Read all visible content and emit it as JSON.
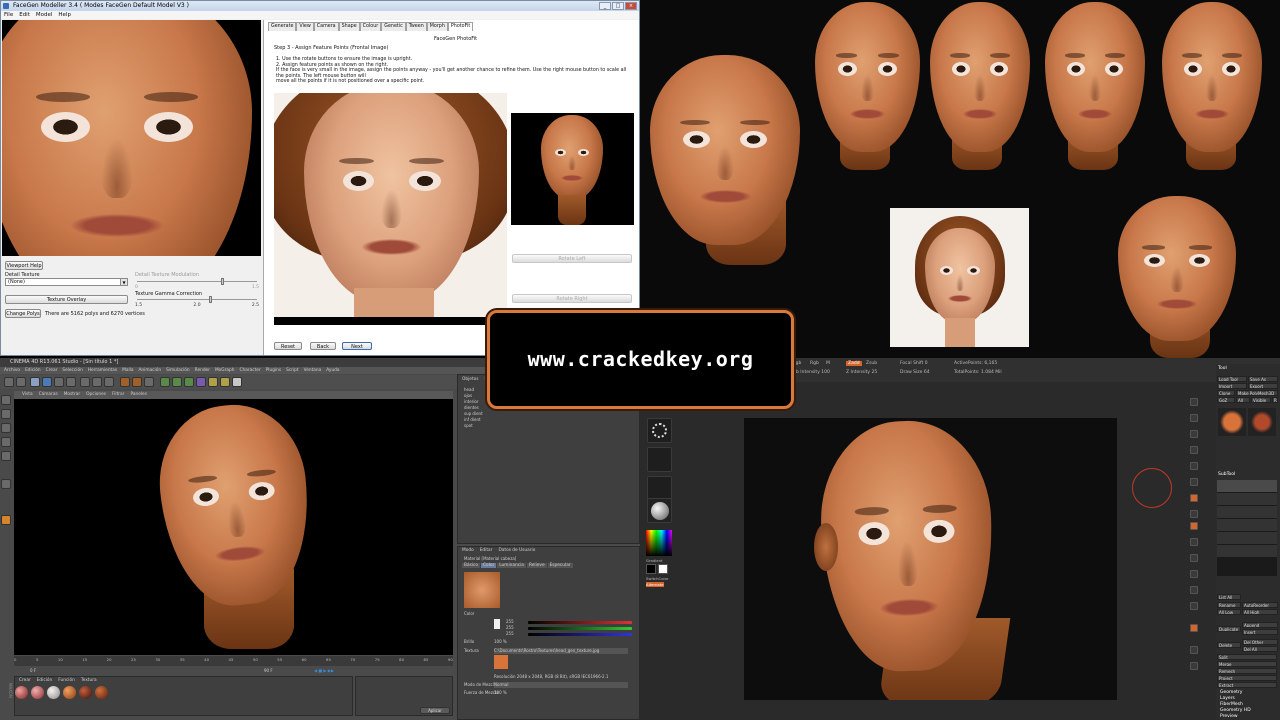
{
  "facegen": {
    "title": "FaceGen Modeller 3.4  ( Modes FaceGen Default Model V3 )",
    "menu": [
      "File",
      "Edit",
      "Model",
      "Help"
    ],
    "viewport_help": "Viewport Help",
    "detail_texture_label": "Detail Texture",
    "detail_texture_value": "(None)",
    "texture_overlay": "Texture Overlay",
    "detail_texture_modulation": "Detail Texture Modulation",
    "modulation_ticks": [
      "0",
      "1.5"
    ],
    "gamma_label": "Texture Gamma Correction",
    "gamma_ticks": [
      "1.5",
      "2.0",
      "2.5"
    ],
    "change_polys": "Change Polys",
    "poly_info": "There are 5162 polys and 6270 vertices",
    "tabs": [
      "Generate",
      "View",
      "Camera",
      "Shape",
      "Colour",
      "Genetic",
      "Tween",
      "Morph",
      "PhotoFit"
    ],
    "photofit_title": "FaceGen PhotoFit",
    "step": "Step 3 - Assign Feature Points (Frontal Image)",
    "instructions": [
      "1. Use the rotate buttons to ensure the image is upright.",
      "2. Assign feature points as shown on the right.",
      "If the face is very small in the image, assign the points anyway - you'll get another chance to refine them. Use the right mouse button to scale all the points. The left mouse button will",
      "move all the points if it is not positioned over a specific point."
    ],
    "rotate_left": "Rotate Left",
    "rotate_right": "Rotate Right",
    "reset": "Reset",
    "back": "Back",
    "next": "Next"
  },
  "banner": {
    "text": "www.crackedkey.org"
  },
  "c4d": {
    "title": "CINEMA 4D R13.061 Studio - [Sin título 1 *]",
    "menu": [
      "Archivo",
      "Edición",
      "Crear",
      "Selección",
      "Herramientas",
      "Malla",
      "Animación",
      "Simulación",
      "Render",
      "MoGraph",
      "Character",
      "Plugins",
      "Script",
      "Ventana",
      "Ayuda"
    ],
    "view_menu": [
      "Vista",
      "Cámaras",
      "Mostrar",
      "Opciones",
      "Filtrar",
      "Paneles"
    ],
    "objects": [
      "Objetos",
      "Etiquetas",
      "Marcadores"
    ],
    "tree_items": [
      "head",
      "ojos",
      "interior",
      "dientes",
      "sup dient",
      "inf dient",
      "spot"
    ],
    "attributes_menu": [
      "Modo",
      "Editar",
      "Datos de Usuario"
    ],
    "material_name": "Material [Material cabeza]",
    "mat_tabs": [
      "Básico",
      "Color",
      "Luminancia",
      "Relieve",
      "Especular"
    ],
    "color_label": "Color",
    "channel_values": [
      "255",
      "255",
      "255"
    ],
    "brightness_label": "Brillo",
    "brightness_value": "100 %",
    "texture_label": "Textura",
    "texture_path": "C:\\Documents\\Rostro\\Textures\\head_gen_texture.jpg",
    "mix_label": "Modo de Mezcla",
    "mix_value": "Normal",
    "mix_strength_label": "Fuerza de Mezcla",
    "mix_strength_value": "100 %",
    "resolution_text": "Resolución 2048 x 2048, RGB (8 Bit), sRGB IEC61966-2.1",
    "material_tabs": [
      "Crear",
      "Edición",
      "Función",
      "Textura"
    ],
    "timeline_ticks": [
      "0",
      "5",
      "10",
      "15",
      "20",
      "25",
      "30",
      "35",
      "40",
      "45",
      "50",
      "55",
      "60",
      "65",
      "70",
      "75",
      "80",
      "85",
      "90"
    ],
    "frame_start": "0 F",
    "frame_end": "90 F",
    "apply": "Aplicar",
    "logo": "MAXON"
  },
  "zbrush": {
    "top_stats": [
      "ActivePoints: 6,165",
      "TotalPoints: 1.084 Mil"
    ],
    "focal_shift": "Focal Shift 0",
    "draw_size": "Draw Size 64",
    "z_intensity": "Z Intensity 25",
    "rgb_intensity": "Rgb Intensity 100",
    "mrgb": "Mrgb",
    "rgb": "Rgb",
    "m": "M",
    "zadd": "Zadd",
    "zsub": "Zsub",
    "edit": "Edit",
    "draw": "Draw",
    "move": "Move",
    "scale": "Scale",
    "rotate": "Rotate",
    "default_zscript": "DefaultZScript",
    "tool_panel": [
      "Tool",
      "Load Tool",
      "Save As",
      "Import",
      "Export",
      "Clone",
      "Make PolyMesh3D",
      "GoZ",
      "All",
      "Visible",
      "R"
    ],
    "subtool_items": [
      "SubTool",
      "List All",
      "Rename",
      "AutoReorder",
      "All Low",
      "All High",
      "Duplicate",
      "Append",
      "Insert",
      "Delete",
      "Del Other",
      "Del All",
      "Split",
      "Merge",
      "Remesh",
      "Project",
      "Extract"
    ],
    "bottom_items": [
      "Geometry",
      "Layers",
      "FiberMesh",
      "Geometry HD",
      "Preview"
    ],
    "gradient": "Gradient",
    "switch_color": "SwitchColor",
    "alternate": "Alternate"
  }
}
